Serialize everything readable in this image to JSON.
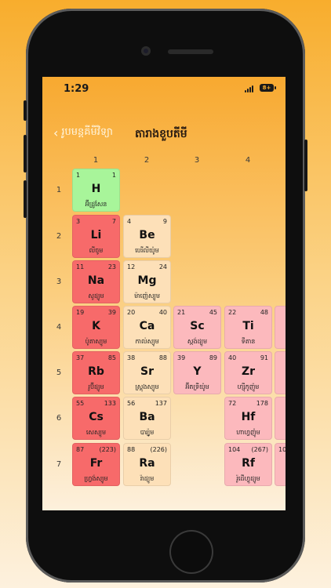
{
  "status": {
    "time": "1:29",
    "battery": "8+"
  },
  "nav": {
    "back_label": "រូបមន្តគីមីវិទ្យា",
    "title": "តារាងខួបតីមី"
  },
  "columns": [
    "1",
    "2",
    "3",
    "4"
  ],
  "rows": [
    "1",
    "2",
    "3",
    "4",
    "5",
    "6",
    "7"
  ],
  "elements": [
    {
      "number": "1",
      "mass": "1",
      "symbol": "H",
      "name": "អ៊ីដ្រូសែន",
      "category": "nonmetal"
    },
    {
      "number": "3",
      "mass": "7",
      "symbol": "Li",
      "name": "លីចូម",
      "category": "alkali"
    },
    {
      "number": "4",
      "mass": "9",
      "symbol": "Be",
      "name": "បេរីលីយ៉ូម",
      "category": "alkaline"
    },
    {
      "number": "11",
      "mass": "23",
      "symbol": "Na",
      "name": "សូដ្យូម",
      "category": "alkali"
    },
    {
      "number": "12",
      "mass": "24",
      "symbol": "Mg",
      "name": "ម៉ាញ៉េស្យូម",
      "category": "alkaline"
    },
    {
      "number": "19",
      "mass": "39",
      "symbol": "K",
      "name": "ប៉ូតាស្យូម",
      "category": "alkali"
    },
    {
      "number": "20",
      "mass": "40",
      "symbol": "Ca",
      "name": "កាល់ស្យូម",
      "category": "alkaline"
    },
    {
      "number": "21",
      "mass": "45",
      "symbol": "Sc",
      "name": "ស្កង់ដ្យូម",
      "category": "transition"
    },
    {
      "number": "22",
      "mass": "48",
      "symbol": "Ti",
      "name": "ទីតាន",
      "category": "transition"
    },
    {
      "number": "37",
      "mass": "85",
      "symbol": "Rb",
      "name": "រូប៊ីដ្យូម",
      "category": "alkali"
    },
    {
      "number": "38",
      "mass": "88",
      "symbol": "Sr",
      "name": "ស្ត្រុងស្យូម",
      "category": "alkaline"
    },
    {
      "number": "39",
      "mass": "89",
      "symbol": "Y",
      "name": "អ៊ីតទ្រីយ៉ូម",
      "category": "transition"
    },
    {
      "number": "40",
      "mass": "91",
      "symbol": "Zr",
      "name": "ហ្ស៊ីកូញ៉ូម",
      "category": "transition"
    },
    {
      "number": "55",
      "mass": "133",
      "symbol": "Cs",
      "name": "សេស្យូម",
      "category": "alkali"
    },
    {
      "number": "56",
      "mass": "137",
      "symbol": "Ba",
      "name": "បារ្យ៉ូម",
      "category": "alkaline"
    },
    {
      "number": "72",
      "mass": "178",
      "symbol": "Hf",
      "name": "ហាហ្វញ៉ូម",
      "category": "transition"
    },
    {
      "number": "87",
      "mass": "(223)",
      "symbol": "Fr",
      "name": "ហ្វ្រង់ស្យូម",
      "category": "alkali"
    },
    {
      "number": "88",
      "mass": "(226)",
      "symbol": "Ra",
      "name": "រ៉ាដ្យូម",
      "category": "alkaline"
    },
    {
      "number": "104",
      "mass": "(267)",
      "symbol": "Rf",
      "name": "រ៉ូដើហ្វូដ្យូម",
      "category": "transition"
    }
  ],
  "partial_cells": [
    {
      "number": "10"
    }
  ]
}
